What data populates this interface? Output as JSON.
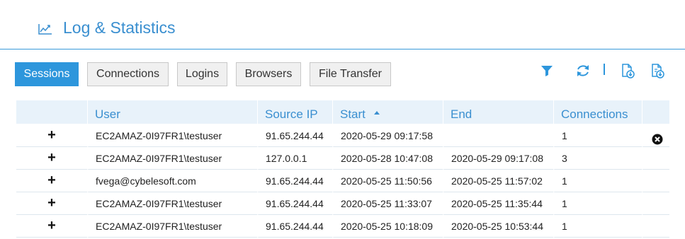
{
  "header": {
    "title": "Log & Statistics",
    "icon": "line-chart-icon"
  },
  "tabs": [
    {
      "label": "Sessions",
      "active": true
    },
    {
      "label": "Connections",
      "active": false
    },
    {
      "label": "Logins",
      "active": false
    },
    {
      "label": "Browsers",
      "active": false
    },
    {
      "label": "File Transfer",
      "active": false
    }
  ],
  "toolbar": {
    "icons": [
      "filter-icon",
      "refresh-icon",
      "export-download-icon",
      "export-download-all-icon"
    ],
    "accent_color": "#2d96dc"
  },
  "table": {
    "columns": [
      "User",
      "Source IP",
      "Start",
      "End",
      "Connections"
    ],
    "sorted_column": "Start",
    "sort_direction": "ascending",
    "rows": [
      {
        "expand": "+",
        "user": "EC2AMAZ-0I97FR1\\testuser",
        "source_ip": "91.65.244.44",
        "start": "2020-05-29 09:17:58",
        "end": "",
        "connections": "1",
        "active": true
      },
      {
        "expand": "+",
        "user": "EC2AMAZ-0I97FR1\\testuser",
        "source_ip": "127.0.0.1",
        "start": "2020-05-28 10:47:08",
        "end": "2020-05-29 09:17:08",
        "connections": "3",
        "active": false
      },
      {
        "expand": "+",
        "user": "fvega@cybelesoft.com",
        "source_ip": "91.65.244.44",
        "start": "2020-05-25 11:50:56",
        "end": "2020-05-25 11:57:02",
        "connections": "1",
        "active": false
      },
      {
        "expand": "+",
        "user": "EC2AMAZ-0I97FR1\\testuser",
        "source_ip": "91.65.244.44",
        "start": "2020-05-25 11:33:07",
        "end": "2020-05-25 11:35:44",
        "connections": "1",
        "active": false
      },
      {
        "expand": "+",
        "user": "EC2AMAZ-0I97FR1\\testuser",
        "source_ip": "91.65.244.44",
        "start": "2020-05-25 10:18:09",
        "end": "2020-05-25 10:53:44",
        "connections": "1",
        "active": false
      }
    ]
  },
  "colors": {
    "accent": "#2d96dc",
    "header_text": "#3a8fd0",
    "table_header_bg": "#e8f2fa"
  }
}
